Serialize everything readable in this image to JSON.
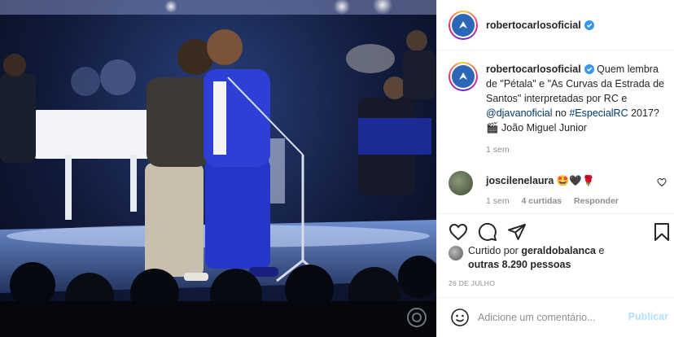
{
  "post": {
    "username": "robertocarlosoficial",
    "caption": {
      "username": "robertocarlosoficial",
      "text_before": " Quem lembra de \"Pétala\" e \"As Curvas da Estrada de Santos\" interpretadas por RC e ",
      "mention": "@djavanoficial",
      "text_middle": " no ",
      "hashtag": "#EspecialRC",
      "text_after": " 2017? 🎬 João Miguel Junior",
      "time": "1 sem"
    },
    "comment": {
      "username": "joscilenelaura",
      "text": " 🤩🖤🌹",
      "time": "1 sem",
      "likes": "4 curtidas",
      "reply_label": "Responder"
    },
    "likes": {
      "prefix": "Curtido por ",
      "liker": "geraldobalanca",
      "middle": " e",
      "others": "outras 8.290 pessoas"
    },
    "date": "26 DE JULHO",
    "comment_placeholder": "Adicione um comentário...",
    "publish_label": "Publicar"
  },
  "icons": {
    "verified": "verified-badge-icon",
    "like": "heart-icon",
    "comment": "comment-icon",
    "share": "send-icon",
    "save": "bookmark-icon",
    "emoji": "emoji-icon"
  },
  "colors": {
    "verified": "#3897f0",
    "link": "#00376b",
    "muted": "#8e8e8e",
    "publish_disabled": "#b2dffc"
  }
}
